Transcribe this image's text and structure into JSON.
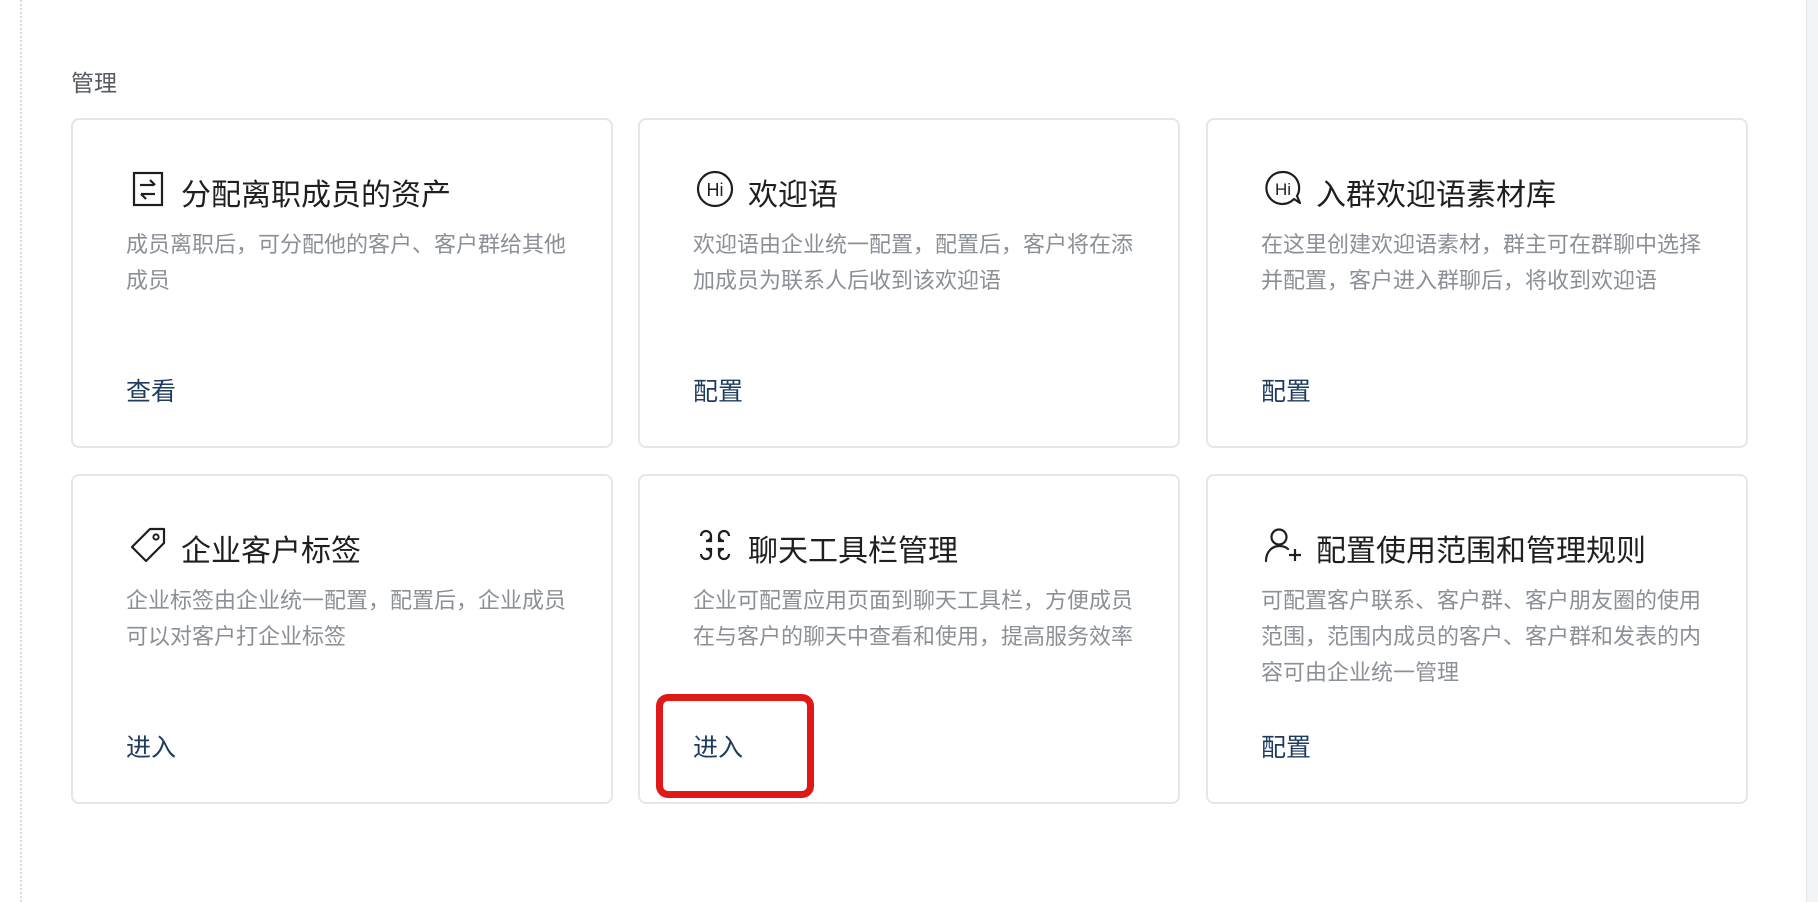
{
  "section": {
    "title": "管理"
  },
  "cards": [
    {
      "icon": "document-transfer-icon",
      "title": "分配离职成员的资产",
      "description": "成员离职后，可分配他的客户、客户群给其他成员",
      "action": "查看"
    },
    {
      "icon": "hi-greeting-icon",
      "title": "欢迎语",
      "description": "欢迎语由企业统一配置，配置后，客户将在添加成员为联系人后收到该欢迎语",
      "action": "配置"
    },
    {
      "icon": "hi-group-chat-icon",
      "title": "入群欢迎语素材库",
      "description": "在这里创建欢迎语素材，群主可在群聊中选择并配置，客户进入群聊后，将收到欢迎语",
      "action": "配置"
    },
    {
      "icon": "tag-icon",
      "title": "企业客户标签",
      "description": "企业标签由企业统一配置，配置后，企业成员可以对客户打企业标签",
      "action": "进入"
    },
    {
      "icon": "toolbar-grid-icon",
      "title": "聊天工具栏管理",
      "description": "企业可配置应用页面到聊天工具栏，方便成员在与客户的聊天中查看和使用，提高服务效率",
      "action": "进入"
    },
    {
      "icon": "user-add-icon",
      "title": "配置使用范围和管理规则",
      "description": "可配置客户联系、客户群、客户朋友圈的使用范围，范围内成员的客户、客户群和发表的内容可由企业统一管理",
      "action": "配置"
    }
  ],
  "colors": {
    "action_text": "#1f3b5e",
    "title_text": "#1f1f1f",
    "description_text": "#8b9097",
    "card_border": "#e3e6ea",
    "highlight": "#e01818"
  }
}
